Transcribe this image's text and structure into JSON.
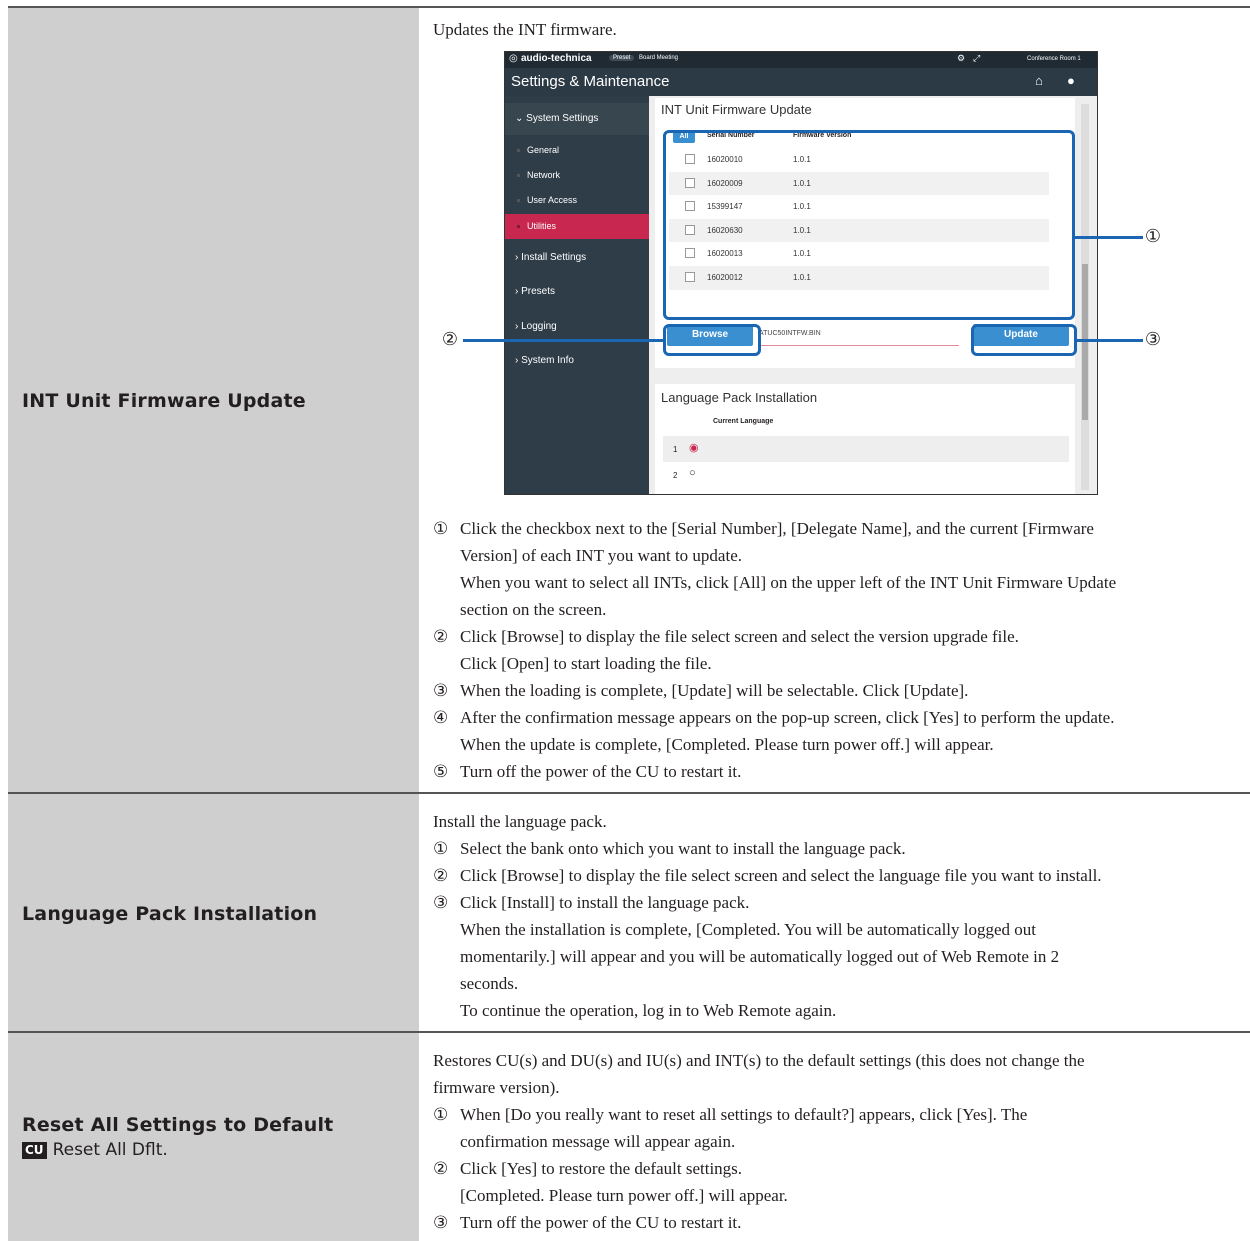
{
  "rows": [
    {
      "title": "INT Unit Firmware Update",
      "intro": "Updates the INT firmware.",
      "steps": [
        {
          "n": "①",
          "text": "Click the checkbox next to the [Serial Number], [Delegate Name], and the current [Firmware"
        },
        {
          "n": "",
          "text": "Version] of each INT you want to update."
        },
        {
          "n": "",
          "text": "When you want to select all INTs, click [All] on the upper left of the INT Unit Firmware Update"
        },
        {
          "n": "",
          "text": "section on the screen."
        },
        {
          "n": "②",
          "text": "Click [Browse] to display the file select screen and select the version upgrade file."
        },
        {
          "n": "",
          "text": "Click [Open] to start loading the file."
        },
        {
          "n": "③",
          "text": "When the loading is complete, [Update] will be selectable. Click [Update]."
        },
        {
          "n": "④",
          "text": "After the confirmation message appears on the pop-up screen, click [Yes] to perform the update."
        },
        {
          "n": "",
          "text": "When the update is complete, [Completed. Please turn power off.] will appear."
        },
        {
          "n": "⑤",
          "text": "Turn off the power of the CU to restart it."
        }
      ]
    },
    {
      "title": "Language Pack Installation",
      "intro": "Install the language pack.",
      "steps": [
        {
          "n": "①",
          "text": "Select the bank onto which you want to install the language pack."
        },
        {
          "n": "②",
          "text": "Click [Browse] to display the file select screen and select the language file you want to install."
        },
        {
          "n": "③",
          "text": "Click [Install] to install the language pack."
        },
        {
          "n": "",
          "text": "When the installation is complete, [Completed. You will be automatically logged out"
        },
        {
          "n": "",
          "text": "momentarily.] will appear and you will be automatically logged out of Web Remote in 2"
        },
        {
          "n": "",
          "text": "seconds."
        },
        {
          "n": "",
          "text": "To continue the operation, log in to Web Remote again."
        }
      ]
    },
    {
      "title": "Reset All Settings to Default",
      "badge": "CU",
      "subtitle": "Reset All Dflt.",
      "intro1": "Restores CU(s) and DU(s) and IU(s) and INT(s) to the default settings (this does not change the",
      "intro2": "firmware version).",
      "steps": [
        {
          "n": "①",
          "text": "When [Do you really want to reset all settings to default?] appears, click [Yes]. The"
        },
        {
          "n": "",
          "text": "confirmation message will appear again."
        },
        {
          "n": "②",
          "text": "Click [Yes] to restore the default settings."
        },
        {
          "n": "",
          "text": "[Completed. Please turn power off.] will appear."
        },
        {
          "n": "③",
          "text": "Turn off the power of the CU to restart it."
        }
      ]
    }
  ],
  "screenshot": {
    "brand": "audio-technica",
    "preset_label": "Preset",
    "preset_value": "Board Meeting",
    "room": "Conference Room 1",
    "title": "Settings & Maintenance",
    "nav": {
      "system_settings": "System Settings",
      "general": "General",
      "network": "Network",
      "user_access": "User Access",
      "utilities": "Utilities",
      "install_settings": "Install Settings",
      "presets": "Presets",
      "logging": "Logging",
      "system_info": "System Info"
    },
    "fw_section_title": "INT Unit Firmware Update",
    "all_button": "All",
    "col_serial": "Serial Number",
    "col_firmware": "Firmware Version",
    "fw_rows": [
      {
        "serial": "16020010",
        "version": "1.0.1"
      },
      {
        "serial": "16020009",
        "version": "1.0.1"
      },
      {
        "serial": "15399147",
        "version": "1.0.1"
      },
      {
        "serial": "16020630",
        "version": "1.0.1"
      },
      {
        "serial": "16020013",
        "version": "1.0.1"
      },
      {
        "serial": "16020012",
        "version": "1.0.1"
      }
    ],
    "browse_button": "Browse",
    "file_name": "ATUC50INTFW.BIN",
    "update_button": "Update",
    "lang_section_title": "Language Pack Installation",
    "col_current_language": "Current Language",
    "lang_rows": [
      "1",
      "2"
    ]
  },
  "callouts": [
    "①",
    "②",
    "③"
  ],
  "colors": {
    "callout_blue": "#1a66b3",
    "active_nav": "#c8274f",
    "label_bg": "#cfcfcf"
  }
}
